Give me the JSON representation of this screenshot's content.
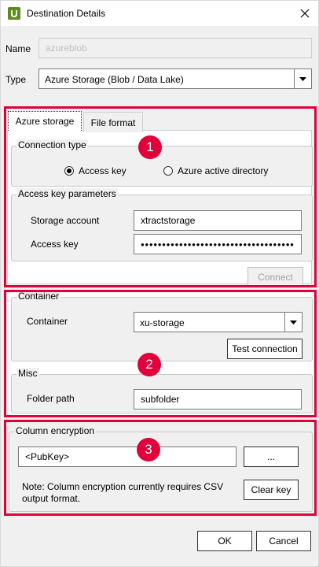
{
  "window": {
    "title": "Destination Details"
  },
  "form": {
    "name_label": "Name",
    "name_value": "azureblob",
    "type_label": "Type",
    "type_value": "Azure Storage (Blob / Data Lake)"
  },
  "tabs": [
    {
      "label": "Azure storage",
      "active": true
    },
    {
      "label": "File format",
      "active": false
    }
  ],
  "connection_type": {
    "title": "Connection type",
    "options": [
      {
        "label": "Access key",
        "selected": true
      },
      {
        "label": "Azure active directory",
        "selected": false
      }
    ]
  },
  "access_key_params": {
    "title": "Access key parameters",
    "storage_account_label": "Storage account",
    "storage_account_value": "xtractstorage",
    "access_key_label": "Access key",
    "access_key_value": "●●●●●●●●●●●●●●●●●●●●●●●●●●●●●●●●●●●●●●●●●●●●●●●●●●●",
    "connect_label": "Connect"
  },
  "container": {
    "title": "Container",
    "label": "Container",
    "value": "xu-storage",
    "test_label": "Test connection"
  },
  "misc": {
    "title": "Misc",
    "folder_label": "Folder path",
    "folder_value": "subfolder"
  },
  "encryption": {
    "title": "Column encryption",
    "pubkey_value": "<PubKey>",
    "browse_label": "...",
    "note": "Note: Column encryption currently requires CSV output format.",
    "clear_label": "Clear key"
  },
  "footer": {
    "ok_label": "OK",
    "cancel_label": "Cancel"
  },
  "badges": [
    "1",
    "2",
    "3"
  ],
  "colors": {
    "highlight": "#e2003b",
    "app_icon": "#5b8c1d"
  }
}
